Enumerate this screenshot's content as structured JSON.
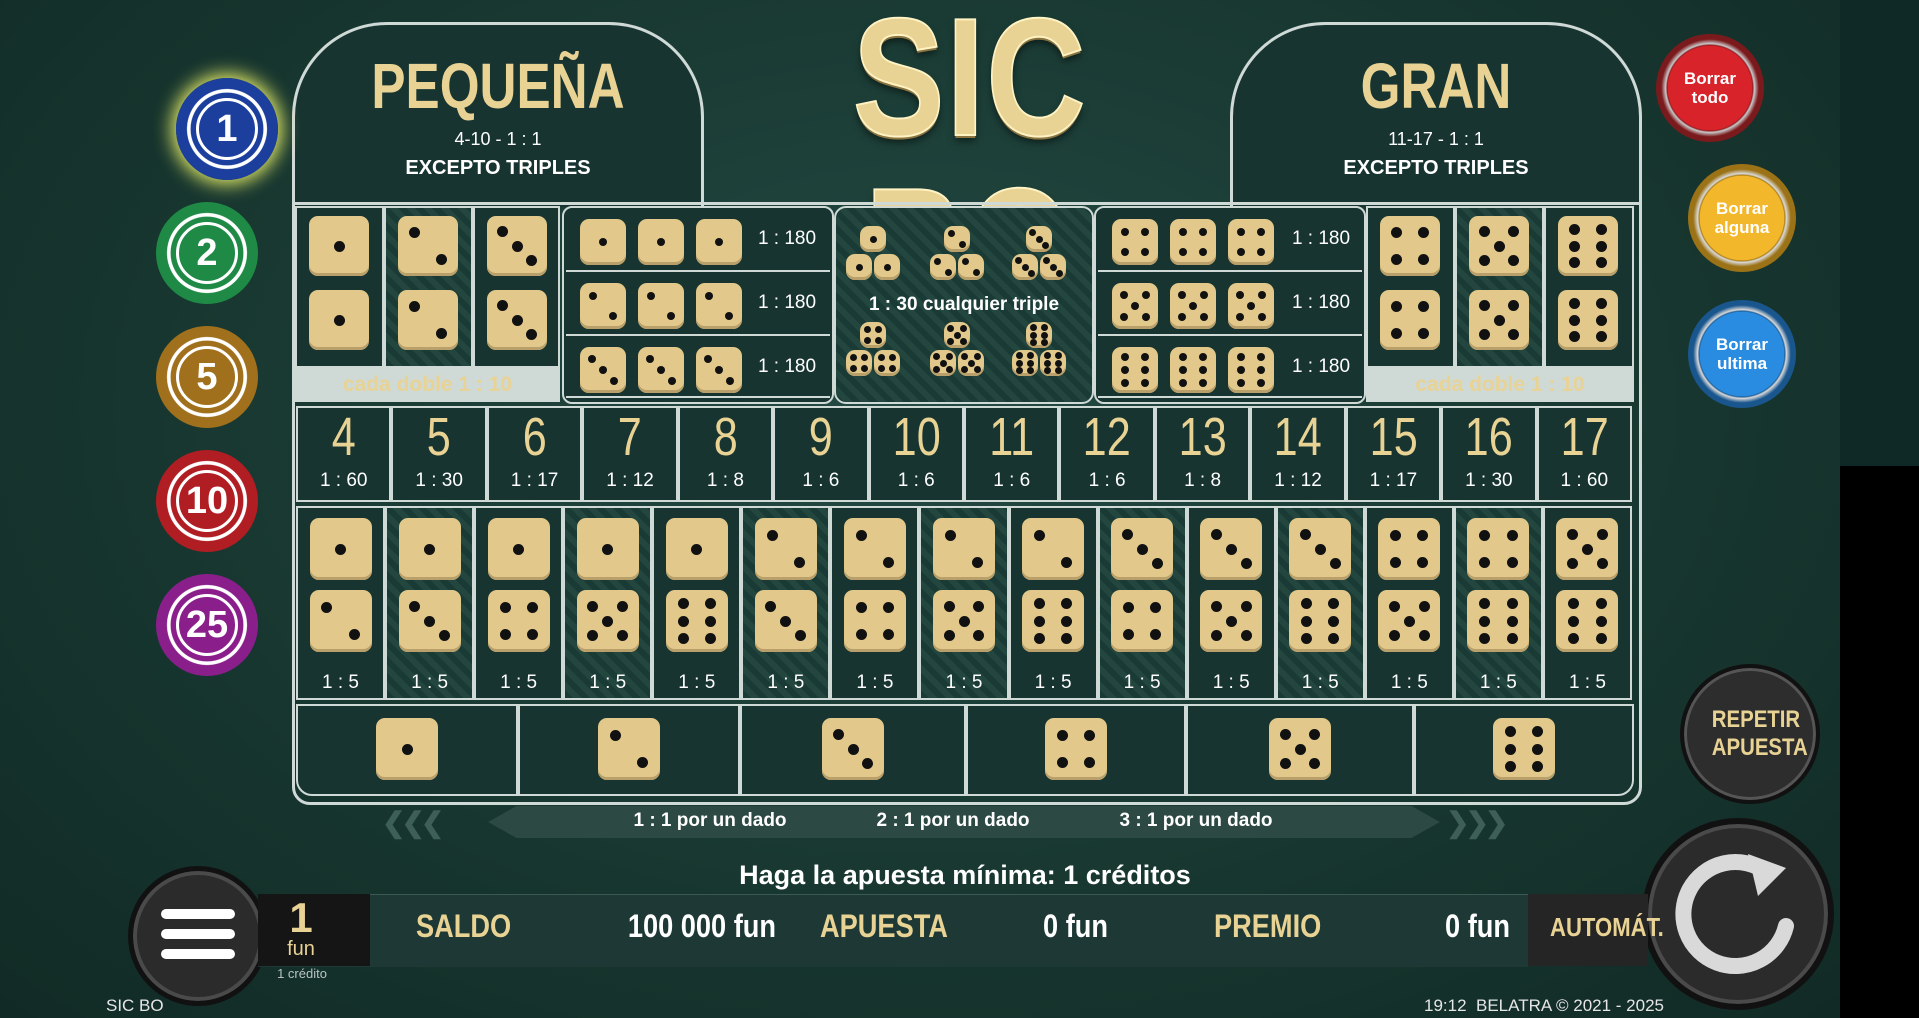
{
  "title": "SIC BO",
  "small_bet": {
    "label": "PEQUEÑA",
    "range": "4-10 - 1 : 1",
    "exception": "EXCEPTO TRIPLES"
  },
  "big_bet": {
    "label": "GRAN",
    "range": "11-17 - 1 : 1",
    "exception": "EXCEPTO TRIPLES"
  },
  "doubles_label": "cada doble 1 : 10",
  "triple_odds": "1 : 180",
  "any_triple_label": "1 : 30 cualquier triple",
  "totals": [
    {
      "n": "4",
      "odds": "1 : 60"
    },
    {
      "n": "5",
      "odds": "1 : 30"
    },
    {
      "n": "6",
      "odds": "1 : 17"
    },
    {
      "n": "7",
      "odds": "1 : 12"
    },
    {
      "n": "8",
      "odds": "1 : 8"
    },
    {
      "n": "9",
      "odds": "1 : 6"
    },
    {
      "n": "10",
      "odds": "1 : 6"
    },
    {
      "n": "11",
      "odds": "1 : 6"
    },
    {
      "n": "12",
      "odds": "1 : 6"
    },
    {
      "n": "13",
      "odds": "1 : 8"
    },
    {
      "n": "14",
      "odds": "1 : 12"
    },
    {
      "n": "15",
      "odds": "1 : 17"
    },
    {
      "n": "16",
      "odds": "1 : 30"
    },
    {
      "n": "17",
      "odds": "1 : 60"
    }
  ],
  "combo_odds": "1 : 5",
  "combos": [
    [
      1,
      2
    ],
    [
      1,
      3
    ],
    [
      1,
      4
    ],
    [
      1,
      5
    ],
    [
      1,
      6
    ],
    [
      2,
      3
    ],
    [
      2,
      4
    ],
    [
      2,
      5
    ],
    [
      2,
      6
    ],
    [
      3,
      4
    ],
    [
      3,
      5
    ],
    [
      3,
      6
    ],
    [
      4,
      5
    ],
    [
      4,
      6
    ],
    [
      5,
      6
    ]
  ],
  "single_payouts": [
    "1 : 1 por un dado",
    "2 : 1 por un dado",
    "3 : 1 por un dado"
  ],
  "chips": [
    {
      "value": "1",
      "color": "#1c3f9e"
    },
    {
      "value": "2",
      "color": "#1e8a45"
    },
    {
      "value": "5",
      "color": "#a0701c"
    },
    {
      "value": "10",
      "color": "#b01d22"
    },
    {
      "value": "25",
      "color": "#8a1f8c"
    }
  ],
  "buttons": {
    "clear_all": "Borrar todo",
    "clear_some": "Borrar alguna",
    "clear_last": "Borrar ultima",
    "repeat": "REPETIR APUESTA",
    "auto": "AUTOMÁT."
  },
  "min_bet_msg": "Haga la apuesta mínima: 1 créditos",
  "bet_unit": {
    "value": "1",
    "unit": "fun",
    "credit": "1 crédito"
  },
  "balance": {
    "label": "SALDO",
    "value": "100 000 fun"
  },
  "bet": {
    "label": "APUESTA",
    "value": "0 fun"
  },
  "win": {
    "label": "PREMIO",
    "value": "0 fun"
  },
  "footer_left": "SIC BO",
  "footer_right": "19:12  BELATRA © 2021 - 2025"
}
